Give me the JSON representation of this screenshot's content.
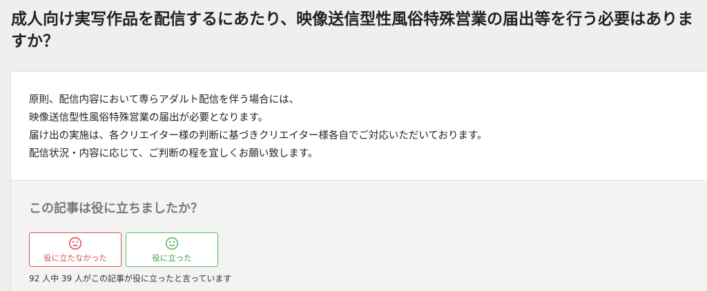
{
  "article": {
    "title": "成人向け実写作品を配信するにあたり、映像送信型性風俗特殊営業の届出等を行う必要はありますか？",
    "body": [
      "原則、配信内容において専らアダルト配信を伴う場合には、",
      "映像送信型性風俗特殊営業の届出が必要となります。",
      "届け出の実施は、各クリエイター様の判断に基づきクリエイター様各自でご対応いただいております。",
      "配信状況・内容に応じて、ご判断の程を宜しくお願い致します。"
    ]
  },
  "feedback": {
    "question": "この記事は役に立ちましたか？",
    "no_label": "役に立たなかった",
    "yes_label": "役に立った",
    "count_text": "92 人中 39 人がこの記事が役に立ったと言っています",
    "no_icon": "neutral-face-icon",
    "yes_icon": "smile-face-icon",
    "no_color": "#d9534f",
    "yes_color": "#5cb85c"
  }
}
